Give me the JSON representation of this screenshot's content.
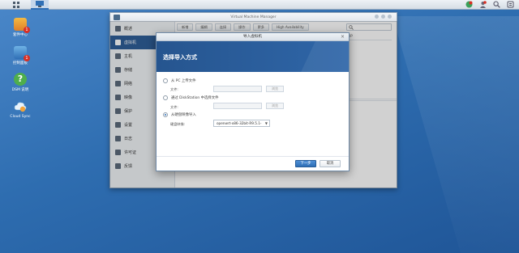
{
  "desktop": {
    "icons": [
      {
        "label": "套件中心",
        "icon": "package-center-icon",
        "badge": "1"
      },
      {
        "label": "控制面板",
        "icon": "control-panel-icon",
        "badge": "1"
      },
      {
        "label": "DSM 说明",
        "icon": "help-icon",
        "badge": ""
      },
      {
        "label": "Cloud Sync",
        "icon": "cloud-sync-icon",
        "badge": ""
      }
    ]
  },
  "taskbar": {
    "icons": [
      "main-menu-icon",
      "vmm-app-icon",
      "notification-icon",
      "user-icon",
      "search-icon",
      "options-icon"
    ]
  },
  "window": {
    "title": "Virtual Machine Manager",
    "toolbar": [
      "新增",
      "编辑",
      "连接",
      "操作",
      "更多",
      "High Availability"
    ],
    "sidebar": [
      {
        "label": "概述",
        "active": false
      },
      {
        "label": "虚拟机",
        "active": true
      },
      {
        "label": "主机",
        "active": false
      },
      {
        "label": "存储",
        "active": false
      },
      {
        "label": "网络",
        "active": false
      },
      {
        "label": "映像",
        "active": false
      },
      {
        "label": "保护",
        "active": false
      },
      {
        "label": "设置",
        "active": false
      },
      {
        "label": "日志",
        "active": false
      },
      {
        "label": "许可证",
        "active": false
      },
      {
        "label": "反馈",
        "active": false
      }
    ],
    "column_ip": "IP"
  },
  "dialog": {
    "title": "导入虚拟机",
    "heading": "选择导入方式",
    "option_pc": "从 PC 上传文件",
    "option_ds": "通过 DiskStation 中选择文件",
    "option_image": "从硬盘映像导入",
    "file_label": "文件:",
    "browse_label": "浏览",
    "image_label": "硬盘映像:",
    "image_value": "openwrt-x86-32bit-R9.5.1-",
    "next_button": "下一步",
    "cancel_button": "取消"
  }
}
